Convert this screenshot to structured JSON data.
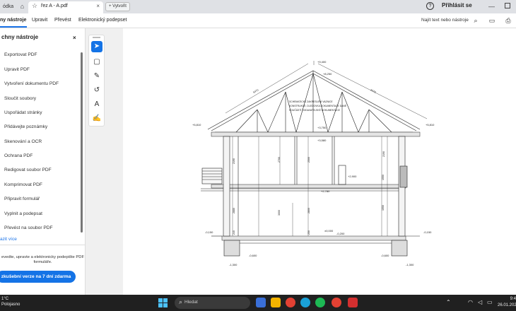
{
  "tabs": {
    "left_partial": "ódka",
    "active_title": "řez A - A.pdf",
    "new_tab": "Vytvořit"
  },
  "header": {
    "login": "Přihlásit se"
  },
  "menu": {
    "items": [
      "ny nástroje",
      "Upravit",
      "Převést",
      "Elektronický podepset"
    ],
    "find_placeholder": "Najít text nebo nástroje"
  },
  "left_panel": {
    "title": "chny nástroje",
    "tools": [
      "Exportovat PDF",
      "Upravit PDF",
      "Vytvoření dokumentu PDF",
      "Sloučit soubory",
      "Uspořádat stránky",
      "Přidávejte poznámky",
      "Skenování a OCR",
      "Ochrana PDF",
      "Redigovat soubor PDF",
      "Komprimovat PDF",
      "Připravit formulář",
      "Vyplnit a podepsat",
      "Převést na soubor PDF"
    ],
    "more": "azit více",
    "promo": "evedte, upravte a elektronicky podepište PDF formuláře.",
    "trial_button": "zkušební verze na 7 dní zdarma"
  },
  "drawing": {
    "note": [
      "SCHEMATICKÉ ZAKRESLENÍ VAZNICE",
      "KONSTRUKCE, DLEDOVKA DOKUMENTACE DANÉ",
      "SOUČÁSTÍ DODAVATELSKÉ DOKUMENTACE"
    ],
    "levels": [
      "+9,400",
      "+8,250",
      "+5,810",
      "+5,810",
      "+3,750",
      "+3,580",
      "+2,900",
      "+2,780",
      "±0,000",
      "-0,150",
      "-0,150",
      "-0,200",
      "-0,600",
      "-0,600",
      "-1,300",
      "-1,300"
    ],
    "dims": [
      "6470",
      "6470",
      "2190",
      "2190",
      "2700",
      "2500",
      "2880",
      "3000",
      "2800",
      "1550",
      "1550",
      "240",
      "250"
    ]
  },
  "taskbar": {
    "weather_temp": "1°C",
    "weather_desc": "Polojasno",
    "search_placeholder": "Hledat",
    "time": "9:4",
    "date": "26.01.202"
  }
}
